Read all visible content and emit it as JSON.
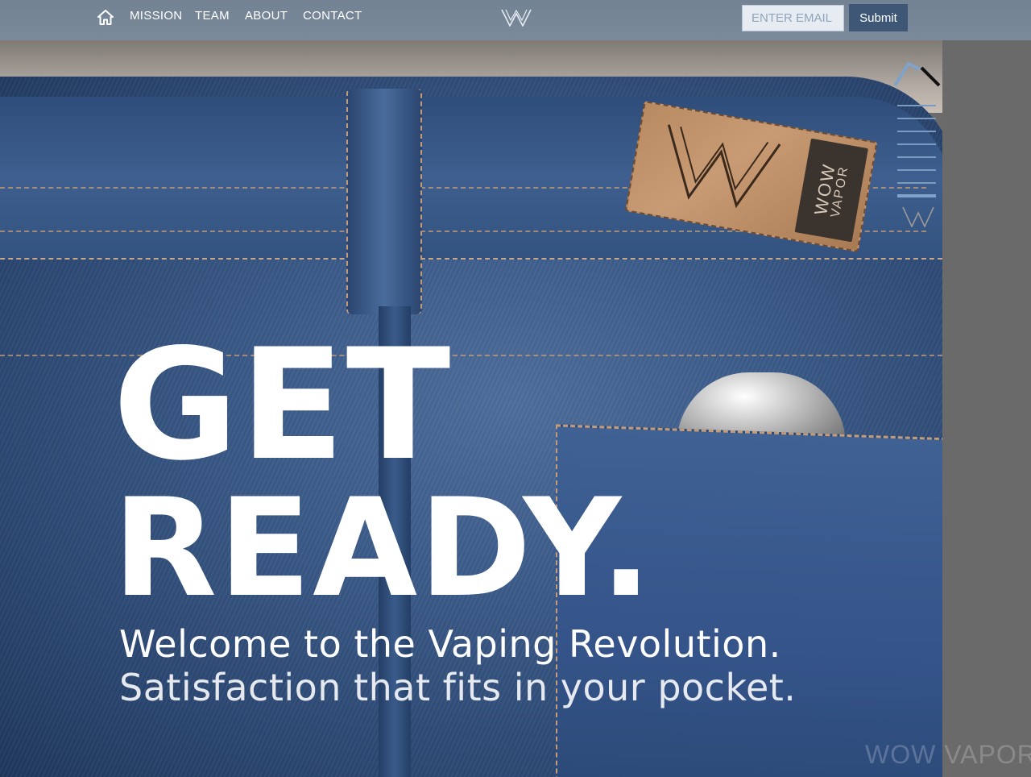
{
  "nav": {
    "home_icon": "home-icon",
    "links": [
      "MISSION",
      "TEAM",
      "ABOUT",
      "CONTACT"
    ],
    "brand_icon": "w-logo-icon",
    "email_placeholder": "ENTER EMAIL",
    "submit_label": "Submit"
  },
  "hero": {
    "headline_line1": "GET",
    "headline_line2": "READY.",
    "tagline_line1": "Welcome to the Vaping Revolution.",
    "tagline_line2": "Satisfaction that fits in your pocket."
  },
  "label": {
    "brand_text_1": "WOW",
    "brand_text_2": "VAPOR"
  },
  "footer": {
    "watermark": "WOW VAPOR"
  },
  "side_nav": {
    "up_icon": "chevron-up-icon",
    "bar_count": 8,
    "active_index": 7,
    "logo_icon": "w-logo-icon"
  },
  "colors": {
    "nav_bg": "#788ea5",
    "submit_bg": "#3f5777",
    "accent": "#7fa3c9"
  }
}
